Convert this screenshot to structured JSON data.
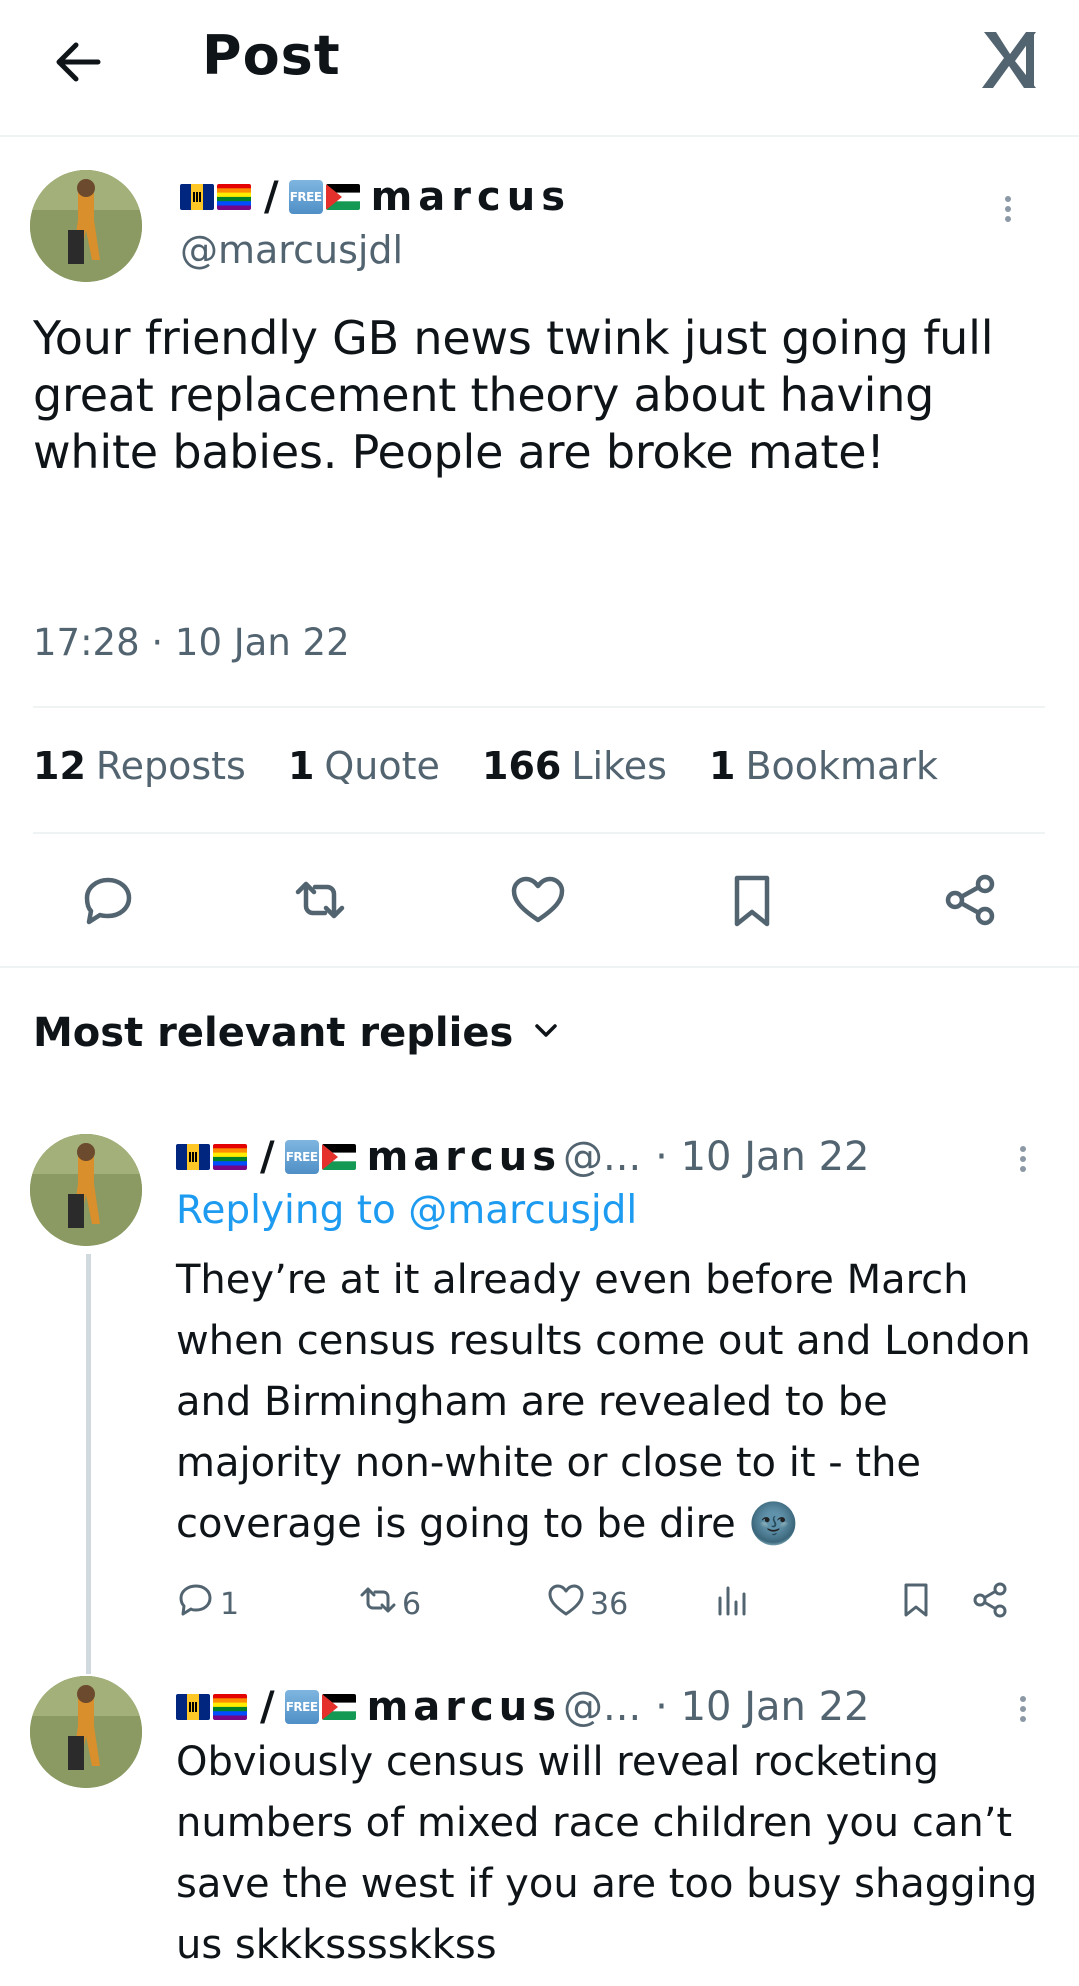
{
  "header": {
    "title": "Post",
    "back_icon": "arrow-left-icon",
    "logo_icon": "x-logo-icon"
  },
  "post": {
    "display_name": "marcus",
    "handle": "@marcusjdl",
    "free_badge": "FREE",
    "separator": "/",
    "text": "Your friendly GB news twink just going full great replacement theory about having white babies. People are broke mate!",
    "time": "17:28 · 10 Jan 22",
    "stats": {
      "reposts_count": "12",
      "reposts_label": "Reposts",
      "quotes_count": "1",
      "quotes_label": "Quote",
      "likes_count": "166",
      "likes_label": "Likes",
      "bookmarks_count": "1",
      "bookmarks_label": "Bookmark"
    },
    "actions": [
      "reply-icon",
      "repost-icon",
      "like-icon",
      "bookmark-icon",
      "share-icon"
    ]
  },
  "replies_section": {
    "title": "Most relevant replies"
  },
  "replies": [
    {
      "display_name": "marcus",
      "handle_trunc": "@...",
      "date": "· 10 Jan 22",
      "replying_prefix": "Replying to",
      "replying_handle": "@marcusjdl",
      "text": "They’re at it already even before March when census results come out and London and Birmingham are revealed to be majority non-white or close to it - the coverage is going to be dire 🌚",
      "reply_count": "1",
      "repost_count": "6",
      "like_count": "36"
    },
    {
      "display_name": "marcus",
      "handle_trunc": "@...",
      "date": "· 10 Jan 22",
      "text": "Obviously census will reveal rocketing numbers of mixed race children you can’t save the west if you are too busy shagging us skkksssskkss"
    }
  ],
  "colors": {
    "text": "#0f1419",
    "secondary": "#536471",
    "link": "#1d9bf0",
    "divider": "#eff3f4"
  }
}
